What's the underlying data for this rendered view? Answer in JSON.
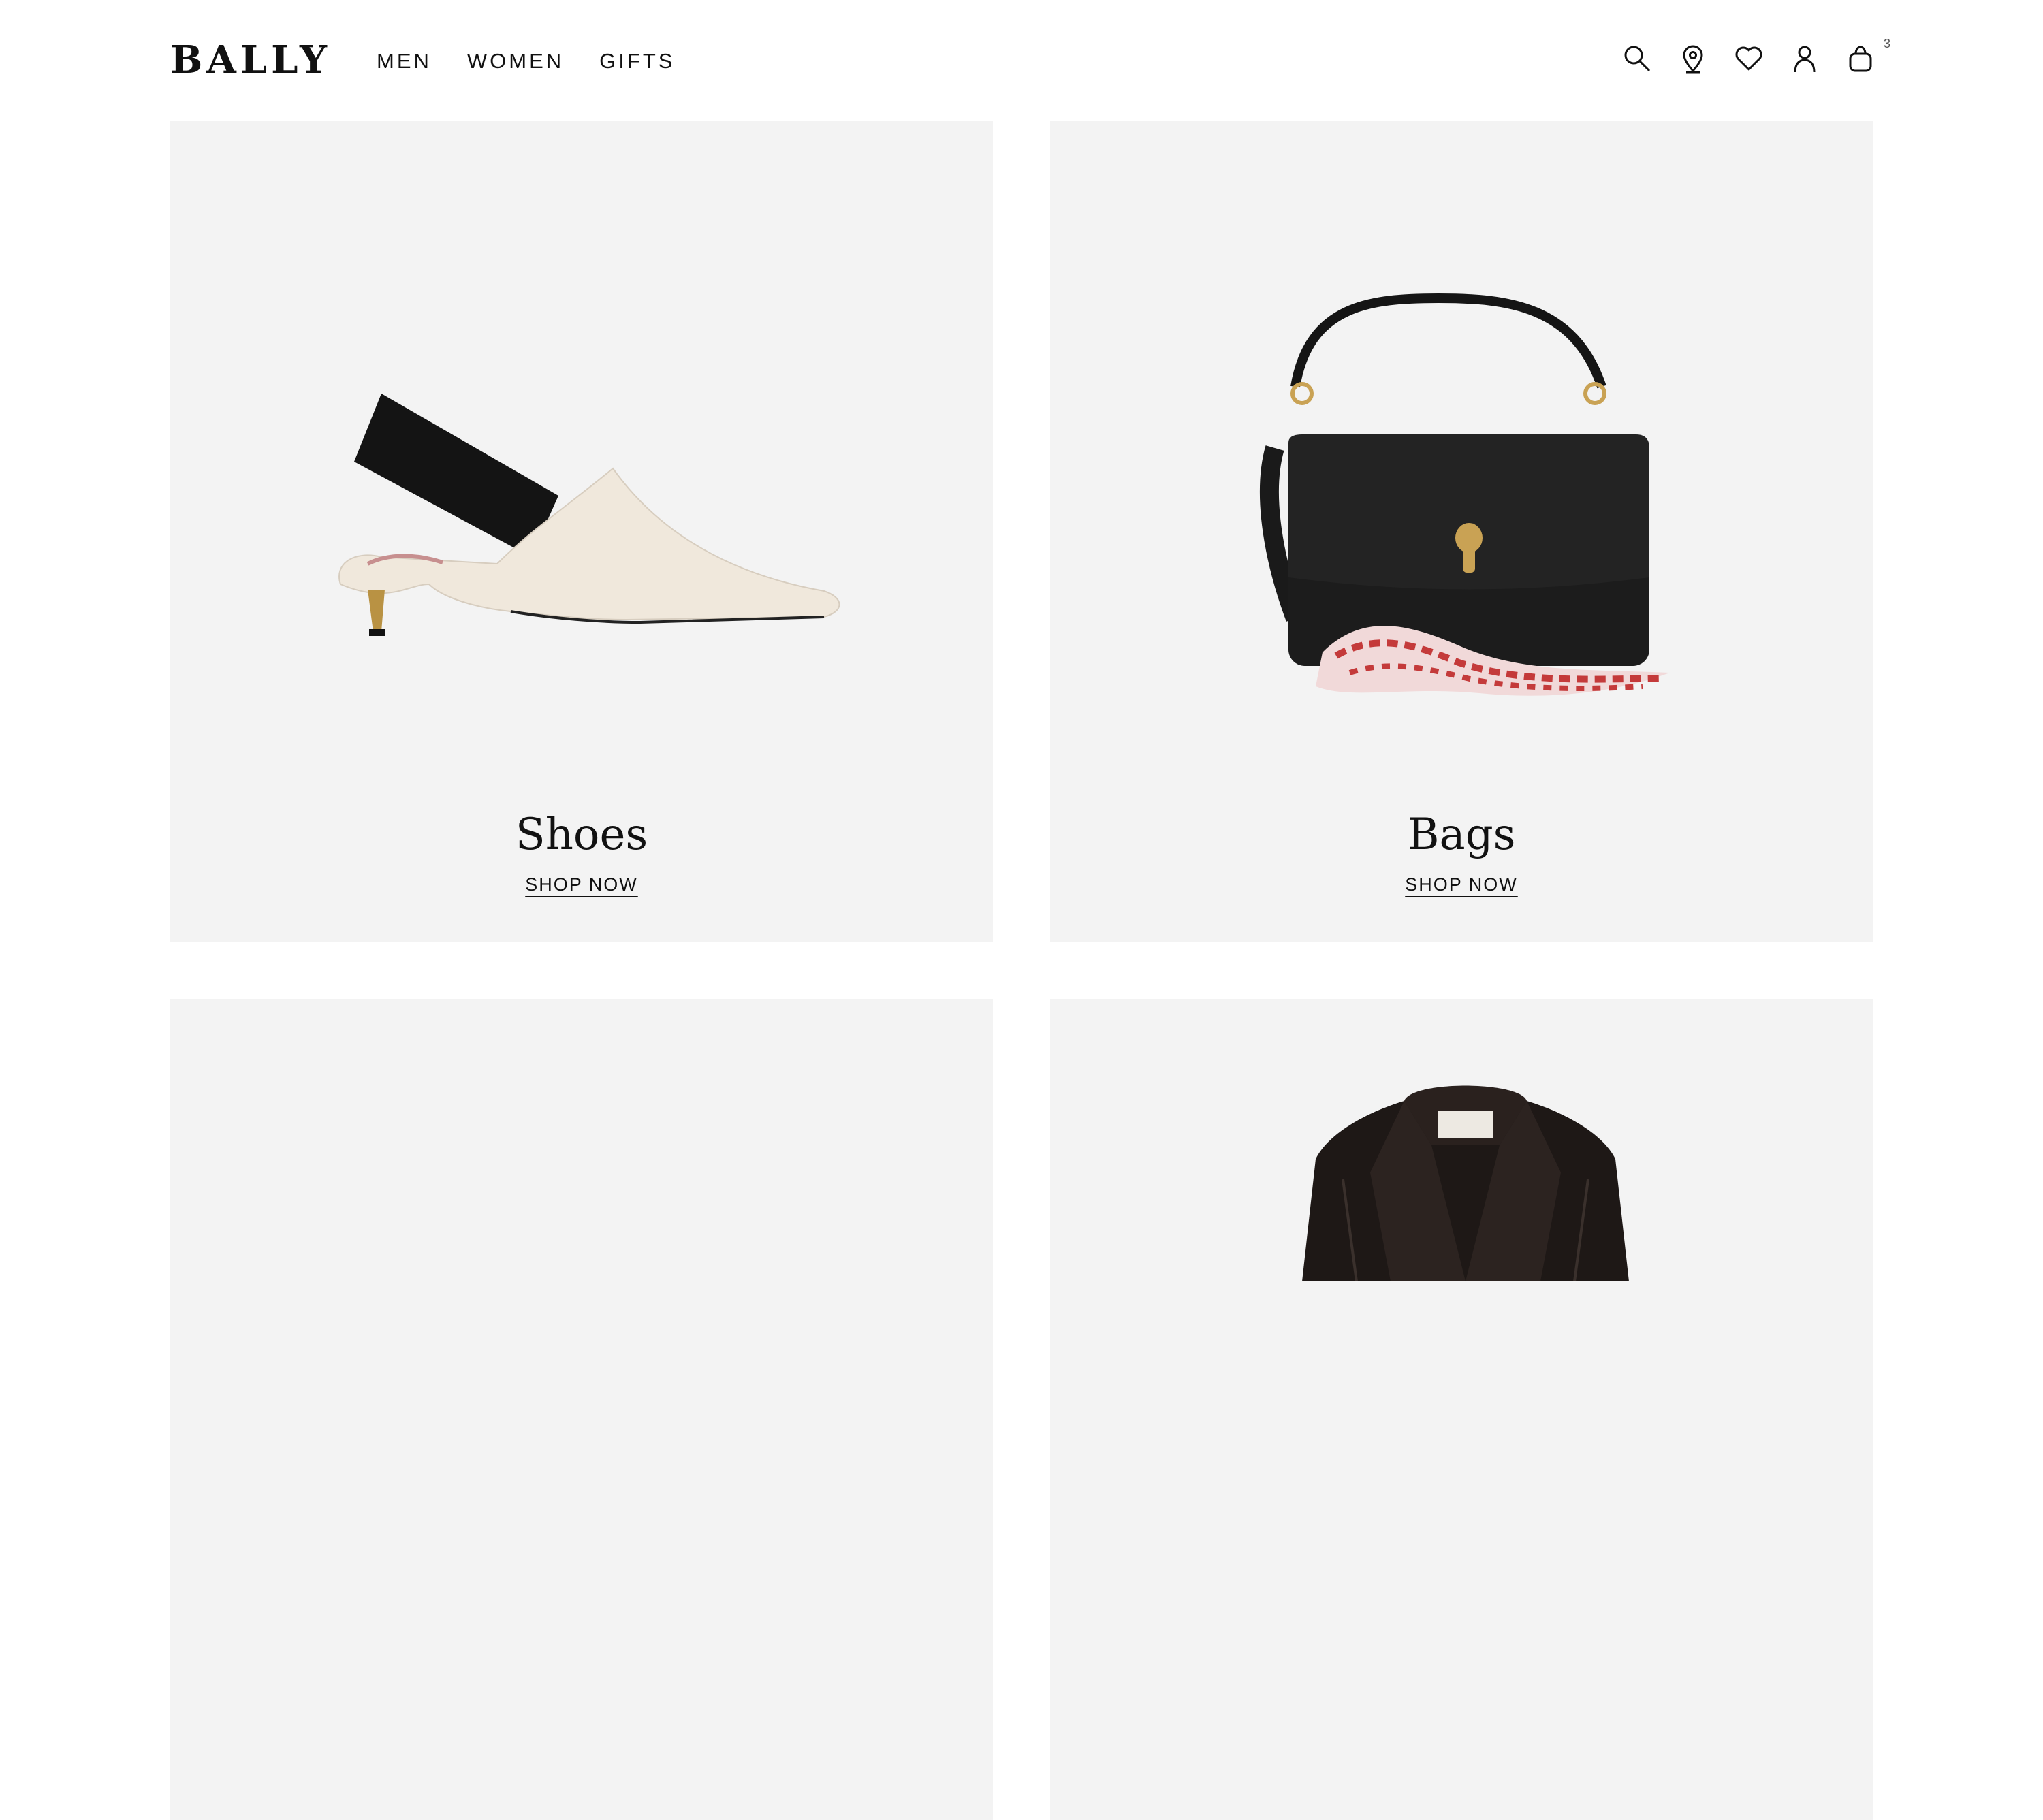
{
  "brand": {
    "logo_text": "BALLY"
  },
  "nav": {
    "items": [
      {
        "label": "MEN"
      },
      {
        "label": "WOMEN"
      },
      {
        "label": "GIFTS"
      }
    ]
  },
  "header_icons": {
    "search": "search-icon",
    "store_locator": "location-pin-icon",
    "wishlist": "heart-icon",
    "account": "user-icon",
    "cart": "shopping-bag-icon",
    "cart_count": "3"
  },
  "categories": [
    {
      "title": "Shoes",
      "cta": "SHOP NOW",
      "product": "slingback pump"
    },
    {
      "title": "Bags",
      "cta": "SHOP NOW",
      "product": "black leather shoulder bag with scarf"
    },
    {
      "title": "",
      "cta": "",
      "product": ""
    },
    {
      "title": "",
      "cta": "",
      "product": "black leather jacket"
    }
  ],
  "colors": {
    "tile_background": "#f3f3f3",
    "text": "#111111"
  }
}
